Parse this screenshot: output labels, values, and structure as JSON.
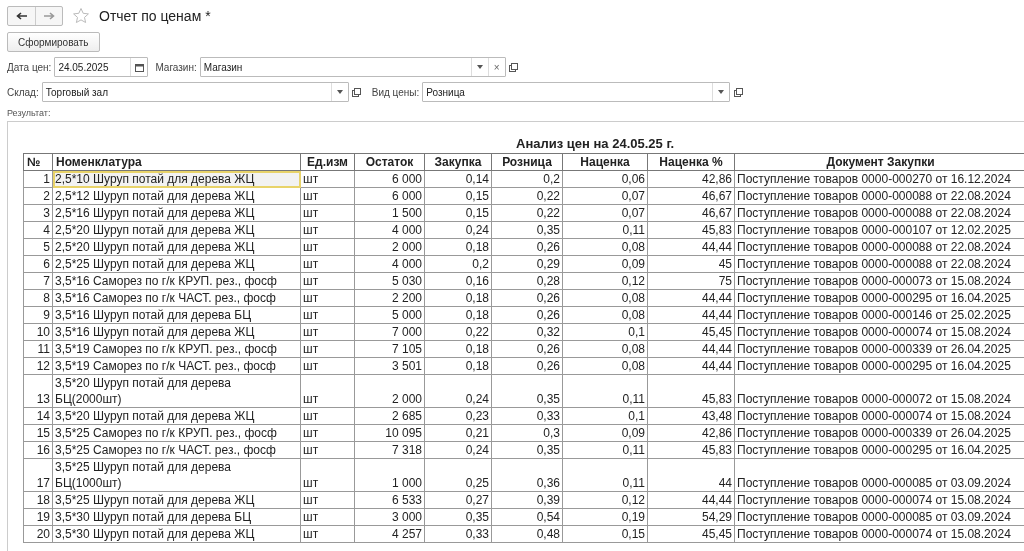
{
  "window": {
    "title": "Отчет по ценам *"
  },
  "toolbar": {
    "generate_button": "Сформировать"
  },
  "filters": {
    "price_date": {
      "label": "Дата цен:",
      "value": "24.05.2025"
    },
    "store": {
      "label": "Магазин:",
      "value": "Магазин",
      "clear": "×"
    },
    "warehouse": {
      "label": "Склад:",
      "value": "Торговый зал"
    },
    "price_type": {
      "label": "Вид цены:",
      "value": "Розница"
    }
  },
  "result_label": "Результат:",
  "report": {
    "title": "Анализ цен на 24.05.25 г.",
    "columns": [
      "№",
      "Номенклатура",
      "Ед.изм",
      "Остаток",
      "Закупка",
      "Розница",
      "Наценка",
      "Наценка %",
      "Документ Закупки"
    ],
    "rows": [
      {
        "num": "1",
        "name": "2,5*10 Шуруп потай для дерева ЖЦ",
        "unit": "шт",
        "stock": "6 000",
        "buy": "0,14",
        "retail": "0,2",
        "markup": "0,06",
        "markup_pct": "42,86",
        "document": "Поступление товаров 0000-000270 от 16.12.2024",
        "selected": true
      },
      {
        "num": "2",
        "name": "2,5*12 Шуруп потай для дерева ЖЦ",
        "unit": "шт",
        "stock": "6 000",
        "buy": "0,15",
        "retail": "0,22",
        "markup": "0,07",
        "markup_pct": "46,67",
        "document": "Поступление товаров 0000-000088 от 22.08.2024",
        "selected": false
      },
      {
        "num": "3",
        "name": "2,5*16 Шуруп потай для дерева ЖЦ",
        "unit": "шт",
        "stock": "1 500",
        "buy": "0,15",
        "retail": "0,22",
        "markup": "0,07",
        "markup_pct": "46,67",
        "document": "Поступление товаров 0000-000088 от 22.08.2024",
        "selected": false
      },
      {
        "num": "4",
        "name": "2,5*20 Шуруп потай для дерева ЖЦ",
        "unit": "шт",
        "stock": "4 000",
        "buy": "0,24",
        "retail": "0,35",
        "markup": "0,11",
        "markup_pct": "45,83",
        "document": "Поступление товаров 0000-000107 от 12.02.2025",
        "selected": false
      },
      {
        "num": "5",
        "name": "2,5*20 Шуруп потай для дерева ЖЦ",
        "unit": "шт",
        "stock": "2 000",
        "buy": "0,18",
        "retail": "0,26",
        "markup": "0,08",
        "markup_pct": "44,44",
        "document": "Поступление товаров 0000-000088 от 22.08.2024",
        "selected": false
      },
      {
        "num": "6",
        "name": "2,5*25 Шуруп потай для дерева ЖЦ",
        "unit": "шт",
        "stock": "4 000",
        "buy": "0,2",
        "retail": "0,29",
        "markup": "0,09",
        "markup_pct": "45",
        "document": "Поступление товаров 0000-000088 от 22.08.2024",
        "selected": false
      },
      {
        "num": "7",
        "name": "3,5*16 Саморез по г/к КРУП. рез., фосф",
        "unit": "шт",
        "stock": "5 030",
        "buy": "0,16",
        "retail": "0,28",
        "markup": "0,12",
        "markup_pct": "75",
        "document": "Поступление товаров 0000-000073 от 15.08.2024",
        "selected": false
      },
      {
        "num": "8",
        "name": "3,5*16 Саморез по г/к ЧАСТ. рез., фосф",
        "unit": "шт",
        "stock": "2 200",
        "buy": "0,18",
        "retail": "0,26",
        "markup": "0,08",
        "markup_pct": "44,44",
        "document": "Поступление товаров 0000-000295 от 16.04.2025",
        "selected": false
      },
      {
        "num": "9",
        "name": "3,5*16 Шуруп потай для дерева БЦ",
        "unit": "шт",
        "stock": "5 000",
        "buy": "0,18",
        "retail": "0,26",
        "markup": "0,08",
        "markup_pct": "44,44",
        "document": "Поступление товаров 0000-000146 от 25.02.2025",
        "selected": false
      },
      {
        "num": "10",
        "name": "3,5*16 Шуруп потай для дерева ЖЦ",
        "unit": "шт",
        "stock": "7 000",
        "buy": "0,22",
        "retail": "0,32",
        "markup": "0,1",
        "markup_pct": "45,45",
        "document": "Поступление товаров 0000-000074 от 15.08.2024",
        "selected": false
      },
      {
        "num": "11",
        "name": "3,5*19 Саморез по г/к КРУП. рез., фосф",
        "unit": "шт",
        "stock": "7 105",
        "buy": "0,18",
        "retail": "0,26",
        "markup": "0,08",
        "markup_pct": "44,44",
        "document": "Поступление товаров 0000-000339 от 26.04.2025",
        "selected": false
      },
      {
        "num": "12",
        "name": "3,5*19 Саморез по г/к ЧАСТ. рез., фосф",
        "unit": "шт",
        "stock": "3 501",
        "buy": "0,18",
        "retail": "0,26",
        "markup": "0,08",
        "markup_pct": "44,44",
        "document": "Поступление товаров 0000-000295 от 16.04.2025",
        "selected": false
      },
      {
        "num": "13",
        "name": "3,5*20 Шуруп потай для дерева БЦ(2000шт)",
        "unit": "шт",
        "stock": "2 000",
        "buy": "0,24",
        "retail": "0,35",
        "markup": "0,11",
        "markup_pct": "45,83",
        "document": "Поступление товаров 0000-000072 от 15.08.2024",
        "selected": false
      },
      {
        "num": "14",
        "name": "3,5*20 Шуруп потай для дерева ЖЦ",
        "unit": "шт",
        "stock": "2 685",
        "buy": "0,23",
        "retail": "0,33",
        "markup": "0,1",
        "markup_pct": "43,48",
        "document": "Поступление товаров 0000-000074 от 15.08.2024",
        "selected": false
      },
      {
        "num": "15",
        "name": "3,5*25 Саморез по г/к КРУП. рез., фосф",
        "unit": "шт",
        "stock": "10 095",
        "buy": "0,21",
        "retail": "0,3",
        "markup": "0,09",
        "markup_pct": "42,86",
        "document": "Поступление товаров 0000-000339 от 26.04.2025",
        "selected": false
      },
      {
        "num": "16",
        "name": "3,5*25 Саморез по г/к ЧАСТ. рез., фосф",
        "unit": "шт",
        "stock": "7 318",
        "buy": "0,24",
        "retail": "0,35",
        "markup": "0,11",
        "markup_pct": "45,83",
        "document": "Поступление товаров 0000-000295 от 16.04.2025",
        "selected": false
      },
      {
        "num": "17",
        "name": "3,5*25 Шуруп потай для дерева БЦ(1000шт)",
        "unit": "шт",
        "stock": "1 000",
        "buy": "0,25",
        "retail": "0,36",
        "markup": "0,11",
        "markup_pct": "44",
        "document": "Поступление товаров 0000-000085 от 03.09.2024",
        "selected": false
      },
      {
        "num": "18",
        "name": "3,5*25 Шуруп потай для дерева ЖЦ",
        "unit": "шт",
        "stock": "6 533",
        "buy": "0,27",
        "retail": "0,39",
        "markup": "0,12",
        "markup_pct": "44,44",
        "document": "Поступление товаров 0000-000074 от 15.08.2024",
        "selected": false
      },
      {
        "num": "19",
        "name": "3,5*30 Шуруп потай для дерева БЦ",
        "unit": "шт",
        "stock": "3 000",
        "buy": "0,35",
        "retail": "0,54",
        "markup": "0,19",
        "markup_pct": "54,29",
        "document": "Поступление товаров 0000-000085 от 03.09.2024",
        "selected": false
      },
      {
        "num": "20",
        "name": "3,5*30 Шуруп потай для дерева ЖЦ",
        "unit": "шт",
        "stock": "4 257",
        "buy": "0,33",
        "retail": "0,48",
        "markup": "0,15",
        "markup_pct": "45,45",
        "document": "Поступление товаров 0000-000074 от 15.08.2024",
        "selected": false
      }
    ]
  }
}
